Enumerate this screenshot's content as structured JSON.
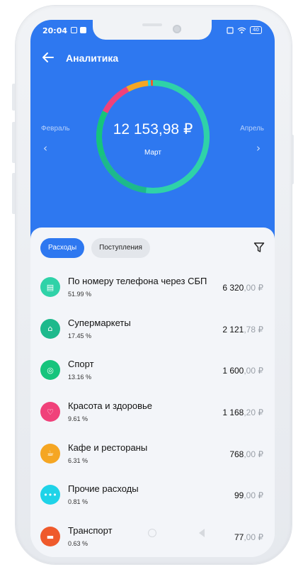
{
  "status": {
    "time": "20:04",
    "battery": "40"
  },
  "header": {
    "title": "Аналитика"
  },
  "summary": {
    "amount": "12 153,98 ₽",
    "month": "Март",
    "prev_month": "Февраль",
    "next_month": "Апрель"
  },
  "tabs": [
    {
      "label": "Расходы",
      "active": true
    },
    {
      "label": "Поступления",
      "active": false
    }
  ],
  "categories": [
    {
      "name": "По номеру телефона через СБП",
      "percent": "51.99 %",
      "amount_int": "6 320",
      "amount_dec": ",00 ₽",
      "color": "#2fd2a8",
      "share": 0.5199,
      "icon": "phone-transfer-icon"
    },
    {
      "name": "Супермаркеты",
      "percent": "17.45 %",
      "amount_int": "2 121",
      "amount_dec": ",78 ₽",
      "color": "#1db98c",
      "share": 0.1745,
      "icon": "store-icon"
    },
    {
      "name": "Спорт",
      "percent": "13.16 %",
      "amount_int": "1 600",
      "amount_dec": ",00 ₽",
      "color": "#16c47c",
      "share": 0.1316,
      "icon": "ball-icon"
    },
    {
      "name": "Красота и здоровье",
      "percent": "9.61 %",
      "amount_int": "1 168",
      "amount_dec": ",20 ₽",
      "color": "#f0417a",
      "share": 0.0961,
      "icon": "heart-icon"
    },
    {
      "name": "Кафе и рестораны",
      "percent": "6.31 %",
      "amount_int": "768",
      "amount_dec": ",00 ₽",
      "color": "#f5a623",
      "share": 0.0631,
      "icon": "cup-icon"
    },
    {
      "name": "Прочие расходы",
      "percent": "0.81 %",
      "amount_int": "99",
      "amount_dec": ",00 ₽",
      "color": "#1fd3e8",
      "share": 0.0081,
      "icon": "dots-icon"
    },
    {
      "name": "Транспорт",
      "percent": "0.63 %",
      "amount_int": "77",
      "amount_dec": ",00 ₽",
      "color": "#ef5a2c",
      "share": 0.0063,
      "icon": "car-icon"
    }
  ]
}
